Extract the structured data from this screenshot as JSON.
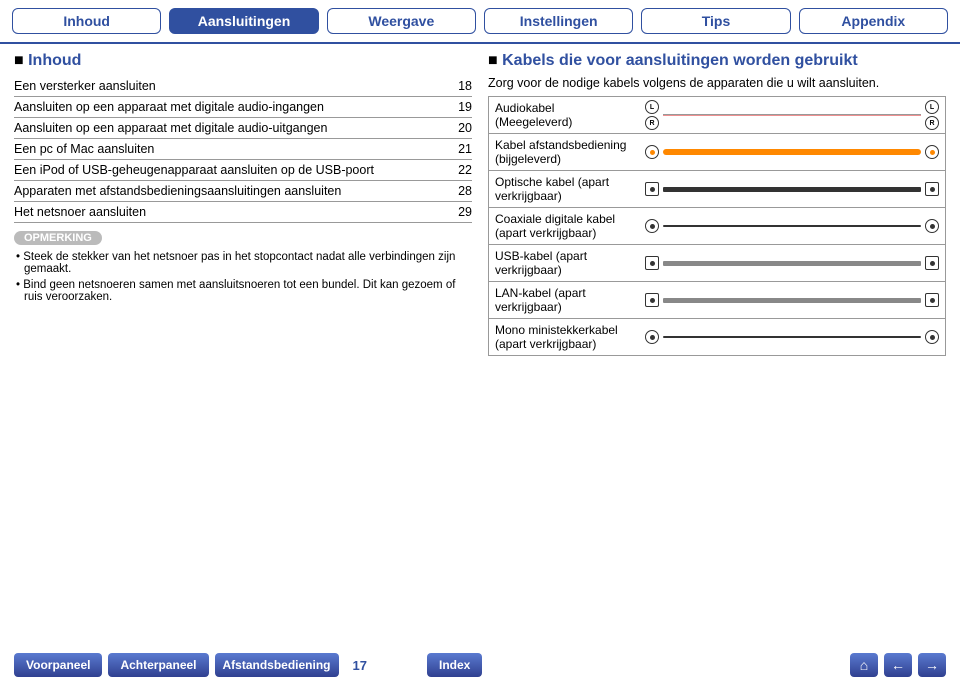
{
  "tabs": [
    "Inhoud",
    "Aansluitingen",
    "Weergave",
    "Instellingen",
    "Tips",
    "Appendix"
  ],
  "activeTab": 1,
  "left": {
    "title": "Inhoud",
    "items": [
      {
        "label": "Een versterker aansluiten",
        "page": "18"
      },
      {
        "label": "Aansluiten op een apparaat met digitale audio-ingangen",
        "page": "19"
      },
      {
        "label": "Aansluiten op een apparaat met digitale audio-uitgangen",
        "page": "20"
      },
      {
        "label": "Een pc of Mac aansluiten",
        "page": "21"
      },
      {
        "label": "Een iPod of USB-geheugenapparaat aansluiten op de USB-poort",
        "page": "22"
      },
      {
        "label": "Apparaten met afstandsbedieningsaansluitingen aansluiten",
        "page": "28"
      },
      {
        "label": "Het netsnoer aansluiten",
        "page": "29"
      }
    ],
    "noteBadge": "OPMERKING",
    "notes": [
      "Steek de stekker van het netsnoer pas in het stopcontact nadat alle verbindingen zijn gemaakt.",
      "Bind geen netsnoeren samen met aansluitsnoeren tot een bundel. Dit kan gezoem of ruis veroorzaken."
    ]
  },
  "right": {
    "title": "Kabels die voor aansluitingen worden gebruikt",
    "intro": "Zorg voor de nodige kabels volgens de apparaten die u wilt aansluiten.",
    "cables": [
      {
        "name": "Audiokabel (Meegeleverd)",
        "type": "rca-stereo"
      },
      {
        "name": "Kabel afstandsbediening (bijgeleverd)",
        "type": "mono-orange"
      },
      {
        "name": "Optische kabel (apart verkrijgbaar)",
        "type": "optical"
      },
      {
        "name": "Coaxiale digitale kabel (apart verkrijgbaar)",
        "type": "coax"
      },
      {
        "name": "USB-kabel (apart verkrijgbaar)",
        "type": "usb"
      },
      {
        "name": "LAN-kabel (apart verkrijgbaar)",
        "type": "lan"
      },
      {
        "name": "Mono ministekkerkabel (apart verkrijgbaar)",
        "type": "mini"
      }
    ]
  },
  "bottom": {
    "buttons": [
      "Voorpaneel",
      "Achterpaneel",
      "Afstandsbediening"
    ],
    "page": "17",
    "index": "Index"
  }
}
